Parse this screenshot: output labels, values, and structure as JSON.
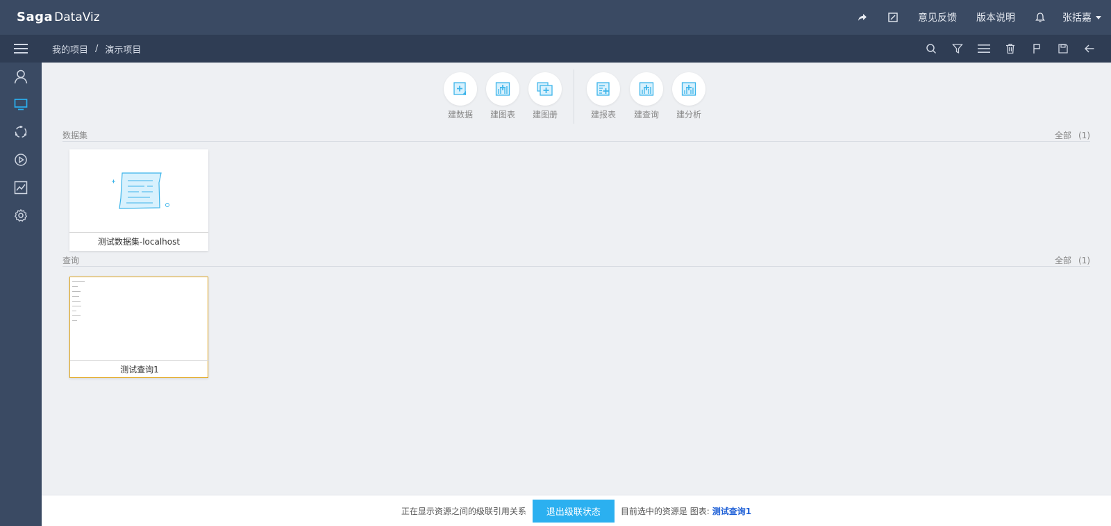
{
  "app": {
    "logo_mark": "Saga",
    "logo_name": "DataViz"
  },
  "topbar": {
    "feedback": "意见反馈",
    "release_notes": "版本说明",
    "user": "张括嘉"
  },
  "breadcrumb": {
    "root": "我的项目",
    "separator": "/",
    "current": "演示项目"
  },
  "actions": [
    {
      "label": "建数据",
      "icon": "new-dataset-icon"
    },
    {
      "label": "建图表",
      "icon": "new-chart-icon"
    },
    {
      "label": "建图册",
      "icon": "new-album-icon"
    },
    {
      "label": "建报表",
      "icon": "new-report-icon"
    },
    {
      "label": "建查询",
      "icon": "new-query-icon"
    },
    {
      "label": "建分析",
      "icon": "new-analysis-icon"
    }
  ],
  "sections": {
    "datasets": {
      "title": "数据集",
      "all_label": "全部",
      "count": "(1)",
      "items": [
        {
          "name": "测试数据集-localhost"
        }
      ]
    },
    "queries": {
      "title": "查询",
      "all_label": "全部",
      "count": "(1)",
      "items": [
        {
          "name": "测试查询1"
        }
      ]
    }
  },
  "status": {
    "message": "正在显示资源之间的级联引用关系",
    "exit_button": "退出级联状态",
    "selected_prefix": "目前选中的资源是 图表:",
    "selected_name": "测试查询1"
  },
  "colors": {
    "topbar": "#3a4a63",
    "subbar": "#2f3d54",
    "accent": "#2bb0f0",
    "selected_border": "#e0a51b"
  }
}
